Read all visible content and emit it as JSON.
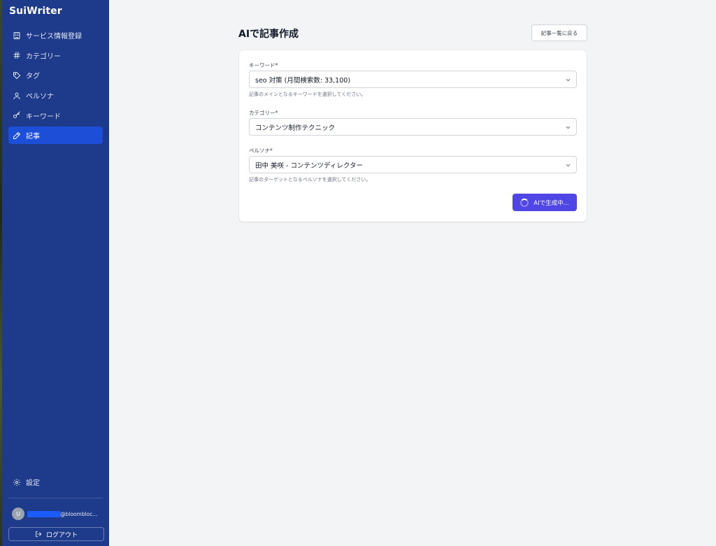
{
  "app": {
    "brand": "SuiWriter"
  },
  "sidebar": {
    "items": [
      {
        "label": "サービス情報登録",
        "icon": "building-icon"
      },
      {
        "label": "カテゴリー",
        "icon": "hash-icon"
      },
      {
        "label": "タグ",
        "icon": "tag-icon"
      },
      {
        "label": "ペルソナ",
        "icon": "user-icon"
      },
      {
        "label": "キーワード",
        "icon": "key-icon"
      },
      {
        "label": "記事",
        "icon": "pencil-icon",
        "active": true
      }
    ],
    "settings_label": "設定",
    "user": {
      "avatar_initial": "U",
      "email_visible": "@bloombloc..."
    },
    "logout_label": "ログアウト"
  },
  "main": {
    "title": "AIで記事作成",
    "back_button": "記事一覧に戻る",
    "form": {
      "keyword": {
        "label": "キーワード*",
        "value": "seo 対策 (月間検索数: 33,100)",
        "hint": "記事のメインとなるキーワードを選択してください。"
      },
      "category": {
        "label": "カテゴリー*",
        "value": "コンテンツ制作テクニック"
      },
      "persona": {
        "label": "ペルソナ*",
        "value": "田中 美咲 - コンテンツディレクター",
        "hint": "記事のターゲットとなるペルソナを選択してください。"
      },
      "submit_label": "AIで生成中..."
    }
  },
  "colors": {
    "sidebar_bg": "#1e3a8a",
    "active_item": "#1d4ed8",
    "primary_button": "#4f46e5",
    "page_bg": "#f3f4f6"
  }
}
